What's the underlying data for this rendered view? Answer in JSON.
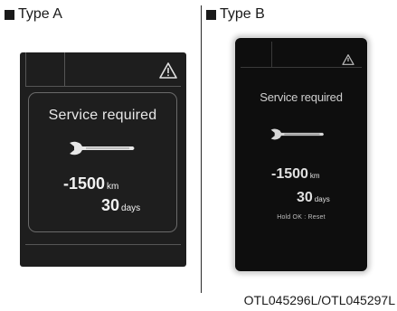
{
  "type_a": {
    "heading": "Type A",
    "message": "Service required",
    "distance_value": "-1500",
    "distance_unit": "km",
    "days_value": "30",
    "days_unit": "days"
  },
  "type_b": {
    "heading": "Type B",
    "message": "Service required",
    "distance_value": "-1500",
    "distance_unit": "km",
    "days_value": "30",
    "days_unit": "days",
    "hint": "Hold OK : Reset"
  },
  "figure_code": "OTL045296L/OTL045297L",
  "icons": {
    "heading_bullet": "square-icon",
    "warning": "warning-triangle-icon",
    "service": "wrench-icon"
  },
  "colors": {
    "display_a_background": "#1e1e1e",
    "display_b_background": "#0e0e0e",
    "text": "#1a1a1a"
  }
}
